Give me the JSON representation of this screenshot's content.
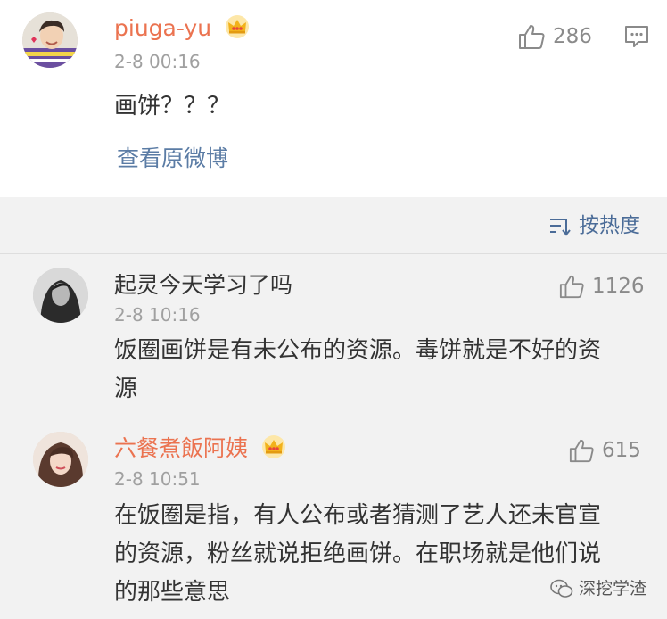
{
  "post": {
    "username": "piuga-yu",
    "time": "2-8 00:16",
    "likes": "286",
    "text": "画饼？？？",
    "view_original_label": "查看原微博"
  },
  "sort": {
    "label": "按热度"
  },
  "comments": [
    {
      "username": "起灵今天学习了吗",
      "time": "2-8 10:16",
      "likes": "1126",
      "text": "饭圈画饼是有未公布的资源。毒饼就是不好的资源"
    },
    {
      "username": "六餐煮飯阿姨",
      "time": "2-8 10:51",
      "likes": "615",
      "text": "在饭圈是指，有人公布或者猜测了艺人还未官宣的资源，粉丝就说拒绝画饼。在职场就是他们说的那些意思"
    }
  ],
  "watermark": {
    "label": "深挖学渣"
  },
  "colors": {
    "vip_name": "#eb7350",
    "link": "#5b7ca5",
    "sort": "#4b6c98",
    "muted": "#a0a0a0",
    "background": "#f2f2f2"
  }
}
